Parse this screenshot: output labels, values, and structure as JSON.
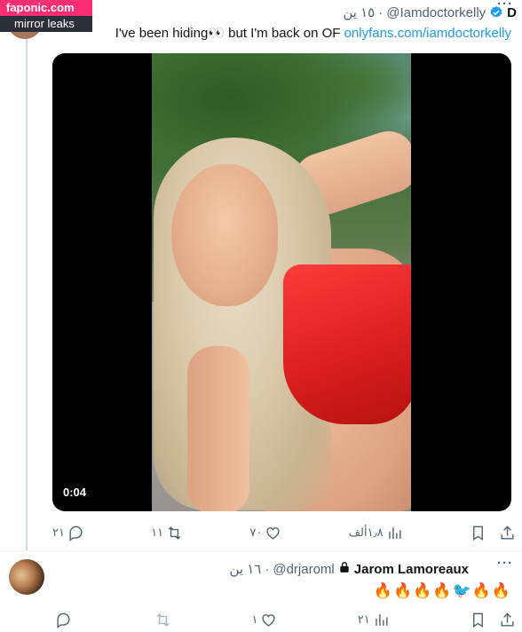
{
  "watermark": {
    "brand": "faponic.com",
    "sub": "mirror leaks"
  },
  "tweet": {
    "name_initial": "D",
    "handle": "@Iamdoctorkelly",
    "separator": "·",
    "time": "١٥ ين",
    "text_before": "I've been hiding👀 but I'm back on OF ",
    "link": "onlyfans.com/iamdoctorkelly",
    "more": "···",
    "video_time": "0:04",
    "actions": {
      "replies": "٢١",
      "retweets": "١١",
      "likes": "٧٠",
      "views": "١٫٨ألف"
    }
  },
  "reply": {
    "name": "Jarom Lamoreaux",
    "handle": "@drjaroml",
    "separator": "·",
    "time": "١٦ ين",
    "text": "🔥🔥🔥🔥🐦🔥🔥",
    "more": "···",
    "actions": {
      "replies": "",
      "retweets": "",
      "likes": "١",
      "views": "٢١"
    }
  },
  "colors": {
    "link": "#1d9bf0",
    "muted": "#536471",
    "verified": "#1d9bf0",
    "brand": "#ff2e72"
  },
  "icons": [
    "reply-icon",
    "retweet-icon",
    "like-icon",
    "views-icon",
    "bookmark-icon",
    "share-icon",
    "verified-icon",
    "lock-icon",
    "more-icon"
  ]
}
